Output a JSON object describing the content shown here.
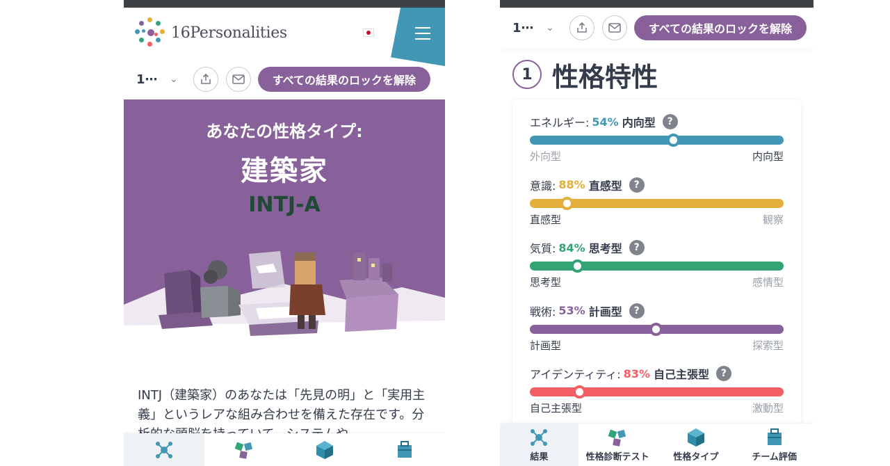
{
  "left": {
    "logo_text": "16Personalities",
    "select_value": "1⋯",
    "unlock_button": "すべての結果のロックを解除",
    "hero": {
      "label": "あなたの性格タイプ:",
      "type_name": "建築家",
      "type_code": "INTJ-A"
    },
    "description": "INTJ（建築家）のあなたは「先見の明」と「実用主義」というレアな組み合わせを備えた存在です。分析的な頭脳を持っていて、システムや"
  },
  "right": {
    "select_value": "1⋯",
    "unlock_button": "すべての結果のロックを解除",
    "section_number": "1",
    "section_title": "性格特性",
    "traits": [
      {
        "label": "エネルギー:",
        "percent": "54%",
        "type": "内向型",
        "value": 54,
        "position": 0.565,
        "color": "#4298b4",
        "left": "外向型",
        "right": "内向型",
        "active": "right"
      },
      {
        "label": "意識:",
        "percent": "88%",
        "type": "直感型",
        "value": 88,
        "position": 0.145,
        "color": "#e4ae3a",
        "left": "直感型",
        "right": "観察",
        "active": "left"
      },
      {
        "label": "気質:",
        "percent": "84%",
        "type": "思考型",
        "value": 84,
        "position": 0.185,
        "color": "#33a474",
        "left": "思考型",
        "right": "感情型",
        "active": "left"
      },
      {
        "label": "戦術:",
        "percent": "53%",
        "type": "計画型",
        "value": 53,
        "position": 0.495,
        "color": "#88619a",
        "left": "計画型",
        "right": "探索型",
        "active": "left"
      },
      {
        "label": "アイデンティティ:",
        "percent": "83%",
        "type": "自己主張型",
        "value": 83,
        "position": 0.195,
        "color": "#f25e62",
        "left": "自己主張型",
        "right": "激動型",
        "active": "left"
      }
    ]
  },
  "nav": [
    {
      "label": "結果",
      "icon": "results-icon"
    },
    {
      "label": "性格診断テスト",
      "icon": "test-icon"
    },
    {
      "label": "性格タイプ",
      "icon": "types-icon"
    },
    {
      "label": "チーム評価",
      "icon": "team-icon"
    }
  ],
  "colors": {
    "purple": "#88619a",
    "blue": "#4298b4",
    "yellow": "#e4ae3a",
    "green": "#33a474",
    "red": "#f25e62"
  }
}
